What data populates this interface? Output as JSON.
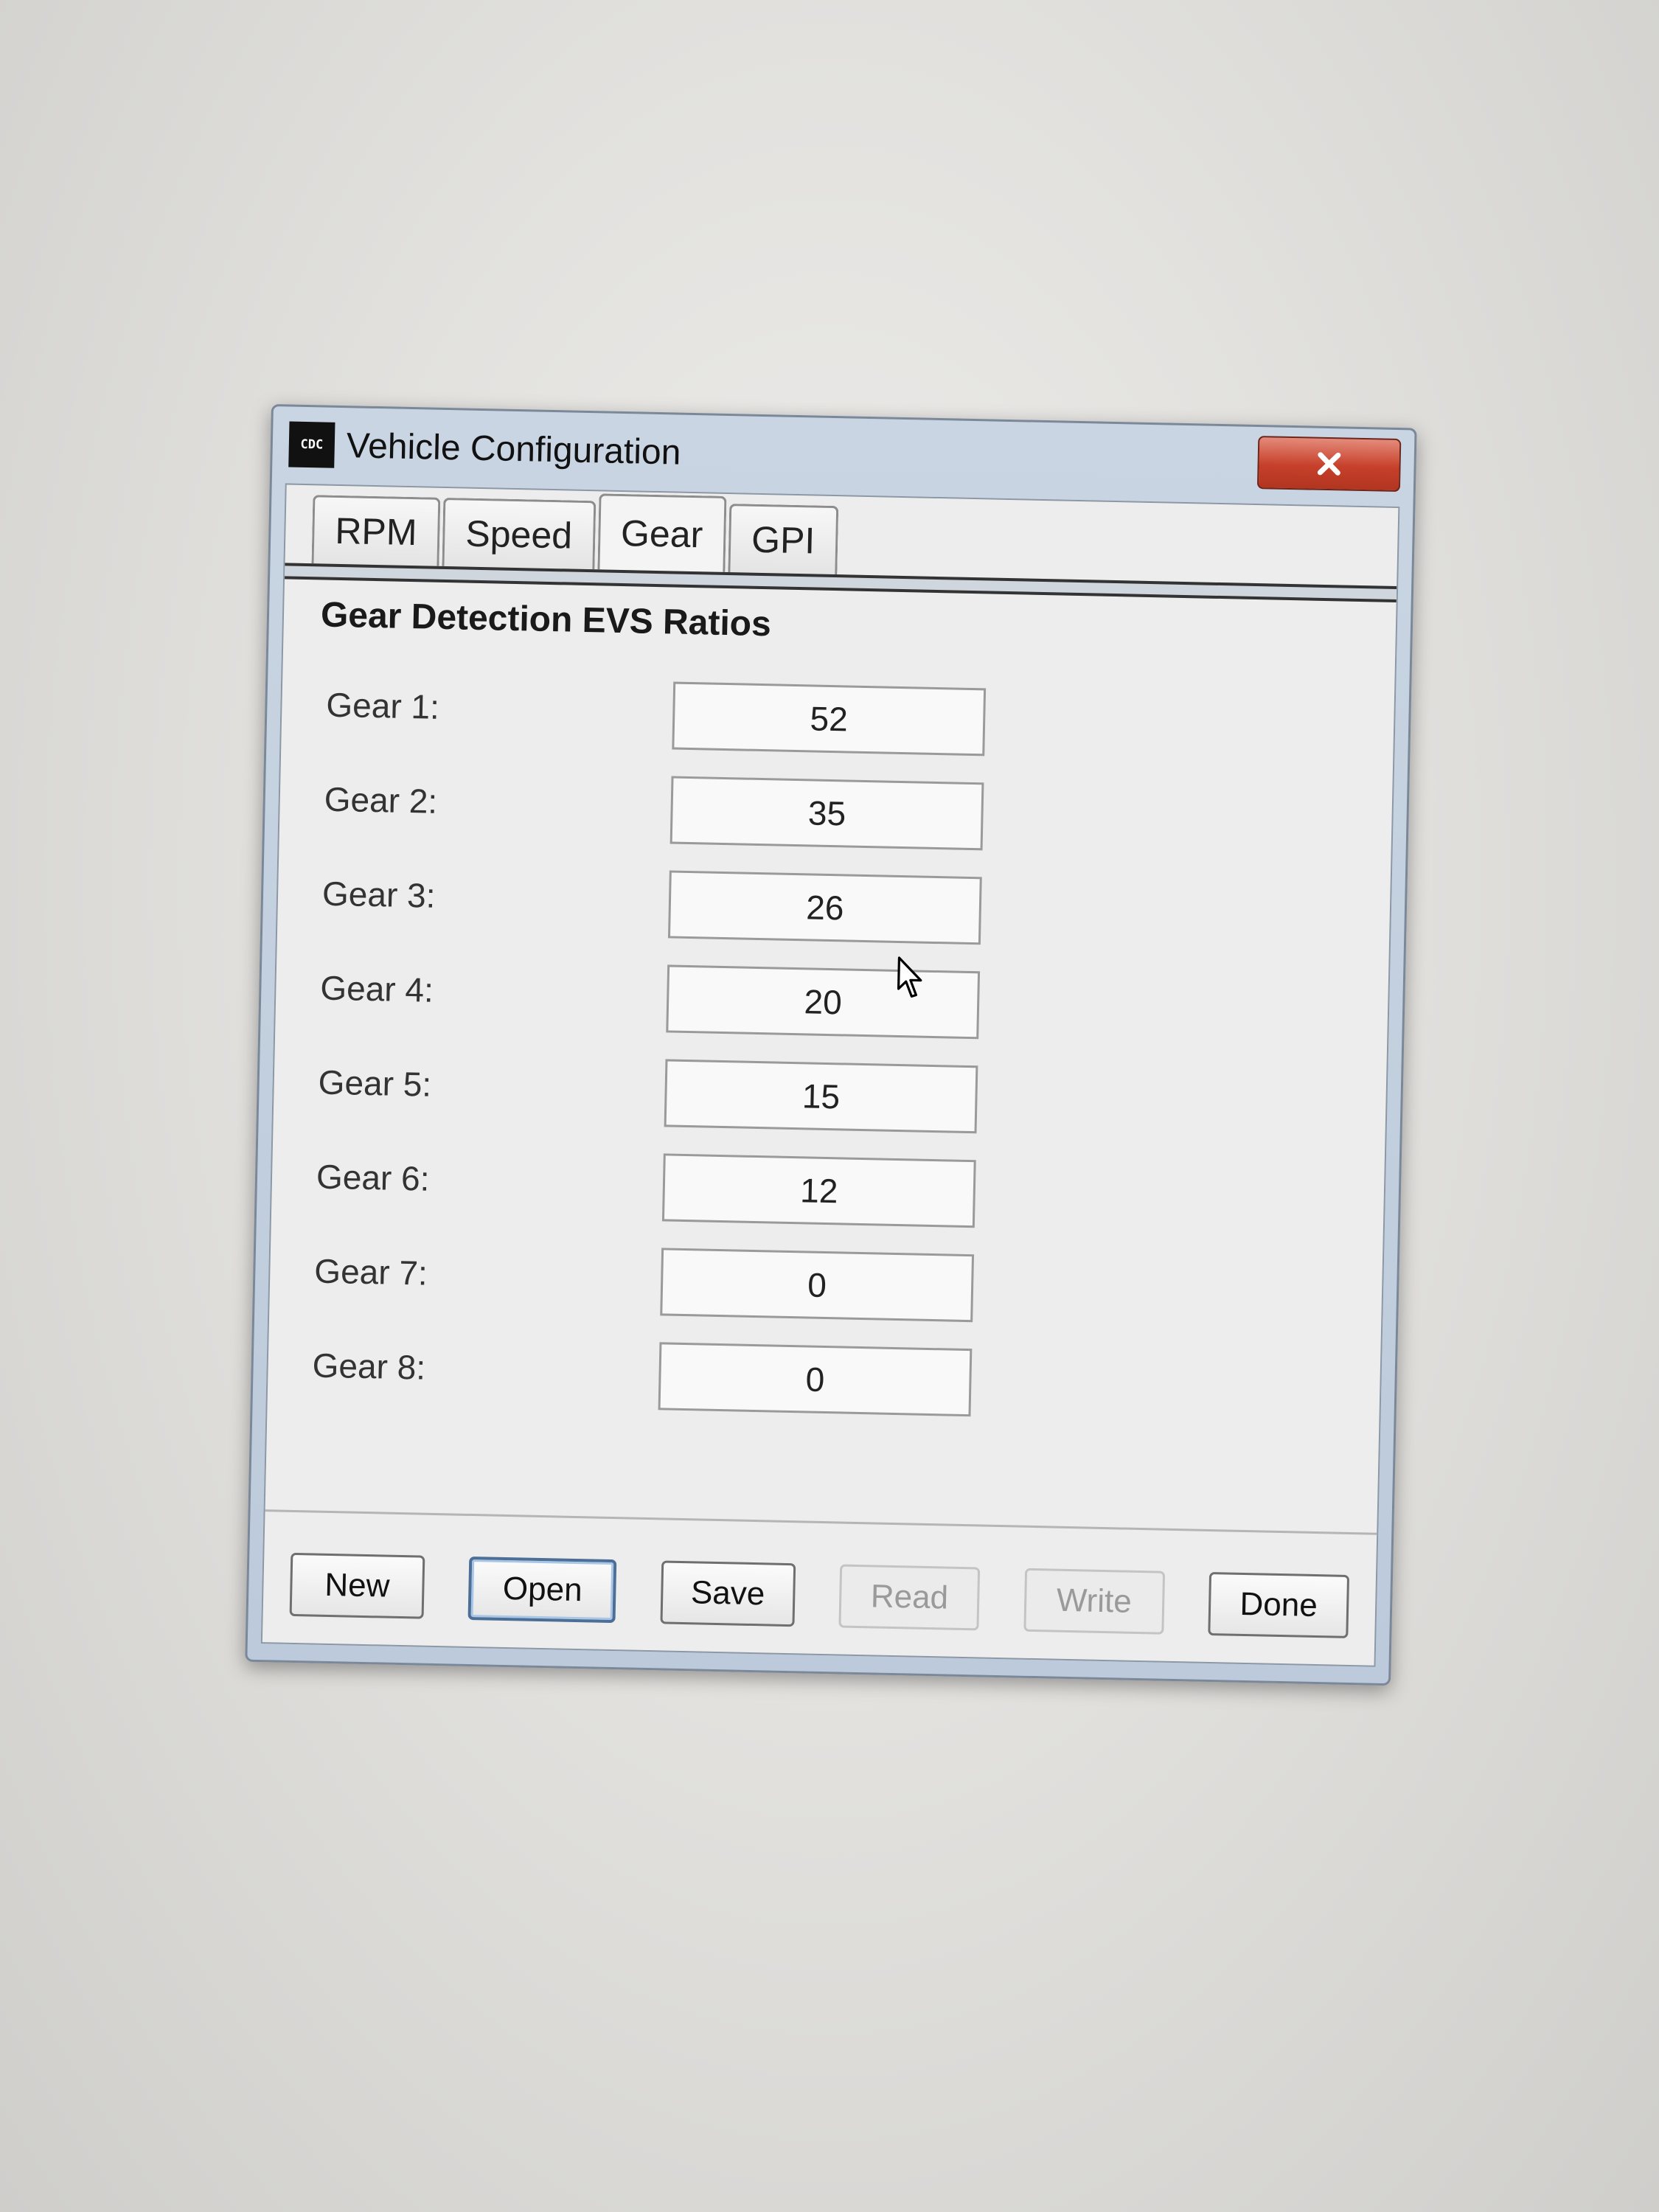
{
  "window": {
    "title": "Vehicle Configuration",
    "app_icon_text": "CDC",
    "close_icon": "close-x-icon"
  },
  "tabs": [
    {
      "label": "RPM",
      "active": false
    },
    {
      "label": "Speed",
      "active": false
    },
    {
      "label": "Gear",
      "active": true
    },
    {
      "label": "GPI",
      "active": false
    }
  ],
  "section": {
    "title": "Gear Detection EVS Ratios"
  },
  "gears": [
    {
      "label": "Gear 1:",
      "value": "52"
    },
    {
      "label": "Gear 2:",
      "value": "35"
    },
    {
      "label": "Gear 3:",
      "value": "26"
    },
    {
      "label": "Gear 4:",
      "value": "20"
    },
    {
      "label": "Gear 5:",
      "value": "15"
    },
    {
      "label": "Gear 6:",
      "value": "12"
    },
    {
      "label": "Gear 7:",
      "value": "0"
    },
    {
      "label": "Gear 8:",
      "value": "0"
    }
  ],
  "buttons": {
    "new": "New",
    "open": "Open",
    "save": "Save",
    "read": "Read",
    "write": "Write",
    "done": "Done"
  },
  "colors": {
    "close_button": "#c6402a",
    "titlebar": "#c9d5e2",
    "client_bg": "#ededed"
  }
}
